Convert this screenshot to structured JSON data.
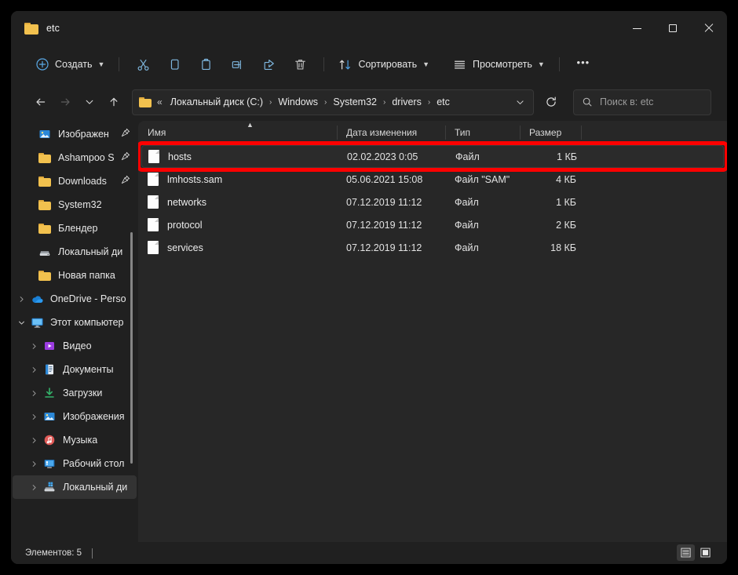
{
  "window": {
    "title": "etc",
    "folder_icon": "folder-icon",
    "controls": {
      "minimize": "minimize-icon",
      "maximize": "maximize-icon",
      "close": "close-icon"
    }
  },
  "toolbar": {
    "new_label": "Создать",
    "cut_label": "cut-icon",
    "copy_label": "copy-icon",
    "paste_label": "paste-icon",
    "rename_label": "rename-icon",
    "share_label": "share-icon",
    "delete_label": "delete-icon",
    "sort_label": "Сортировать",
    "view_label": "Просмотреть",
    "more_label": "•••"
  },
  "address": {
    "back": "back-arrow-icon",
    "forward": "forward-arrow-icon",
    "recent": "chevron-down-icon",
    "up": "up-arrow-icon",
    "overflow": "«",
    "crumbs": [
      "Локальный диск (C:)",
      "Windows",
      "System32",
      "drivers",
      "etc"
    ],
    "separator": "›",
    "dropdown": "chevron-down-icon",
    "refresh": "refresh-icon"
  },
  "search": {
    "placeholder": "Поиск в: etc",
    "value": "",
    "icon": "search-icon"
  },
  "sidebar": {
    "items": [
      {
        "label": "Изображен",
        "icon": "pictures-icon",
        "indent": 1,
        "expander": "none",
        "pinned": true,
        "selected": false
      },
      {
        "label": "Ashampoo S",
        "icon": "folder-icon",
        "indent": 1,
        "expander": "none",
        "pinned": true,
        "selected": false
      },
      {
        "label": "Downloads",
        "icon": "folder-icon",
        "indent": 1,
        "expander": "none",
        "pinned": true,
        "selected": false
      },
      {
        "label": "System32",
        "icon": "folder-icon",
        "indent": 1,
        "expander": "none",
        "pinned": false,
        "selected": false
      },
      {
        "label": "Блендер",
        "icon": "folder-icon",
        "indent": 1,
        "expander": "none",
        "pinned": false,
        "selected": false
      },
      {
        "label": "Локальный ди",
        "icon": "drive-icon",
        "indent": 1,
        "expander": "none",
        "pinned": false,
        "selected": false
      },
      {
        "label": "Новая папка",
        "icon": "folder-icon",
        "indent": 1,
        "expander": "none",
        "pinned": false,
        "selected": false
      },
      {
        "label": "OneDrive - Perso",
        "icon": "onedrive-icon",
        "indent": 0,
        "expander": "collapsed",
        "pinned": false,
        "selected": false
      },
      {
        "label": "Этот компьютер",
        "icon": "this-pc-icon",
        "indent": 0,
        "expander": "expanded",
        "pinned": false,
        "selected": false
      },
      {
        "label": "Видео",
        "icon": "videos-icon",
        "indent": 1,
        "expander": "collapsed",
        "pinned": false,
        "selected": false
      },
      {
        "label": "Документы",
        "icon": "documents-icon",
        "indent": 1,
        "expander": "collapsed",
        "pinned": false,
        "selected": false
      },
      {
        "label": "Загрузки",
        "icon": "downloads-icon",
        "indent": 1,
        "expander": "collapsed",
        "pinned": false,
        "selected": false
      },
      {
        "label": "Изображения",
        "icon": "pictures-icon",
        "indent": 1,
        "expander": "collapsed",
        "pinned": false,
        "selected": false
      },
      {
        "label": "Музыка",
        "icon": "music-icon",
        "indent": 1,
        "expander": "collapsed",
        "pinned": false,
        "selected": false
      },
      {
        "label": "Рабочий стол",
        "icon": "desktop-icon",
        "indent": 1,
        "expander": "collapsed",
        "pinned": false,
        "selected": false
      },
      {
        "label": "Локальный ди",
        "icon": "local-disk-icon",
        "indent": 1,
        "expander": "collapsed",
        "pinned": false,
        "selected": true
      }
    ]
  },
  "file_list": {
    "columns": [
      {
        "key": "name",
        "label": "Имя",
        "sorted": "asc"
      },
      {
        "key": "date",
        "label": "Дата изменения",
        "sorted": "none"
      },
      {
        "key": "type",
        "label": "Тип",
        "sorted": "none"
      },
      {
        "key": "size",
        "label": "Размер",
        "sorted": "none"
      }
    ],
    "rows": [
      {
        "name": "hosts",
        "date": "02.02.2023 0:05",
        "type": "Файл",
        "size": "1 КБ",
        "highlighted": true
      },
      {
        "name": "lmhosts.sam",
        "date": "05.06.2021 15:08",
        "type": "Файл \"SAM\"",
        "size": "4 КБ",
        "highlighted": false
      },
      {
        "name": "networks",
        "date": "07.12.2019 11:12",
        "type": "Файл",
        "size": "1 КБ",
        "highlighted": false
      },
      {
        "name": "protocol",
        "date": "07.12.2019 11:12",
        "type": "Файл",
        "size": "2 КБ",
        "highlighted": false
      },
      {
        "name": "services",
        "date": "07.12.2019 11:12",
        "type": "Файл",
        "size": "18 КБ",
        "highlighted": false
      }
    ]
  },
  "annotation": {
    "color": "#ff0000",
    "target": "hosts"
  },
  "statusbar": {
    "items_count_label": "Элементов: 5",
    "view_details": "details-view-icon",
    "view_large_icons": "large-icons-view-icon"
  }
}
